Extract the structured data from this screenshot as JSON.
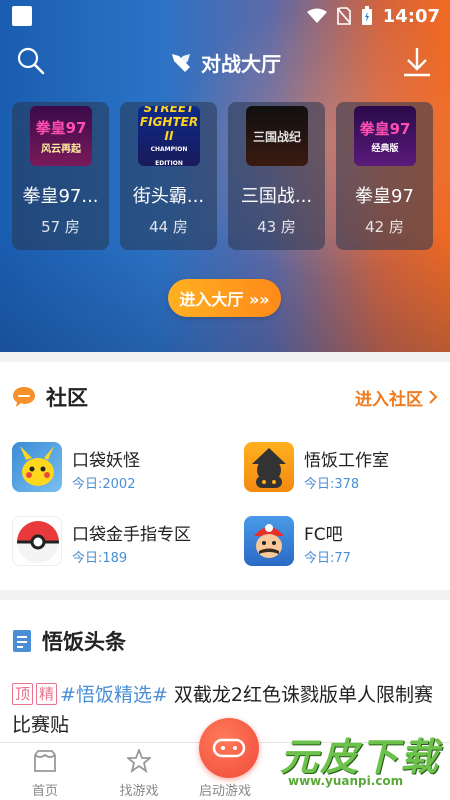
{
  "status": {
    "time": "14:07"
  },
  "header": {
    "title": "对战大厅"
  },
  "games": [
    {
      "name": "拳皇97...",
      "rooms": "57 房",
      "art_main": "拳皇97",
      "art_sub": "风云再起"
    },
    {
      "name": "街头霸...",
      "rooms": "44 房",
      "art_main": "STREET FIGHTER II",
      "art_sub": "CHAMPION EDITION"
    },
    {
      "name": "三国战...",
      "rooms": "43 房",
      "art_main": "三国战纪",
      "art_sub": ""
    },
    {
      "name": "拳皇97",
      "rooms": "42 房",
      "art_main": "拳皇97",
      "art_sub": "经典版"
    }
  ],
  "enter_hall": "进入大厅 »»",
  "community": {
    "title": "社区",
    "more": "进入社区",
    "items": [
      {
        "name": "口袋妖怪",
        "today": "今日:2002"
      },
      {
        "name": "悟饭工作室",
        "today": "今日:378"
      },
      {
        "name": "口袋金手指专区",
        "today": "今日:189"
      },
      {
        "name": "FC吧",
        "today": "今日:77"
      }
    ]
  },
  "news": {
    "title": "悟饭头条",
    "tag_top": "顶",
    "tag_best": "精",
    "hashtag": "#悟饭精选#",
    "headline": " 双截龙2红色诛戮版单人限制赛比赛贴"
  },
  "nav": {
    "home": "首页",
    "find": "找游戏",
    "launch": "启动游戏"
  },
  "watermark": {
    "title": "元皮下载",
    "url": "www.yuanpi.com"
  },
  "colors": {
    "accent": "#f07a1e",
    "link": "#4a8fd6",
    "tag": "#e8738c"
  }
}
